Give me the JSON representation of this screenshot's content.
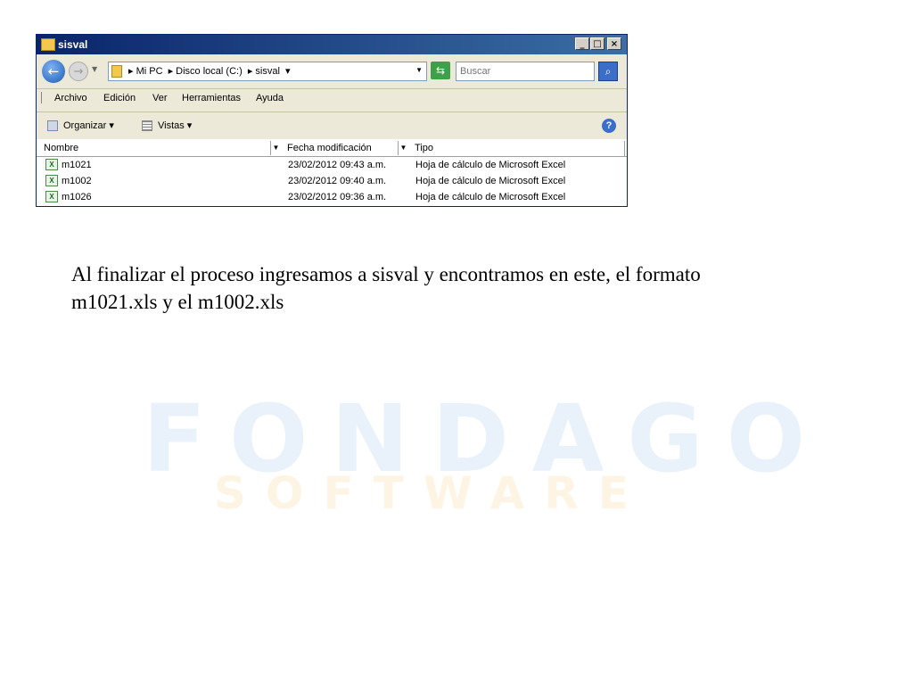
{
  "window": {
    "title": "sisval",
    "buttons": {
      "minimize": "_",
      "maximize": "□",
      "close": "×"
    }
  },
  "address_bar": {
    "crumbs": [
      "▸ Mi PC",
      "▸ Disco local (C:)",
      "▸ sisval",
      "▾"
    ],
    "search_placeholder": "Buscar"
  },
  "menu": [
    "Archivo",
    "Edición",
    "Ver",
    "Herramientas",
    "Ayuda"
  ],
  "command_bar": {
    "organize": "Organizar ▾",
    "views": "Vistas ▾",
    "help": "?"
  },
  "columns": [
    "Nombre",
    "Fecha modificación",
    "Tipo"
  ],
  "files": [
    {
      "name": "m1021",
      "date": "23/02/2012 09:43 a.m.",
      "type": "Hoja de cálculo de Microsoft Excel"
    },
    {
      "name": "m1002",
      "date": "23/02/2012 09:40 a.m.",
      "type": "Hoja de cálculo de Microsoft Excel"
    },
    {
      "name": "m1026",
      "date": "23/02/2012 09:36 a.m.",
      "type": "Hoja de cálculo de Microsoft Excel"
    }
  ],
  "caption": "Al finalizar el proceso ingresamos a sisval y encontramos en este, el formato m1021.xls y el m1002.xls",
  "watermark": {
    "word": "FONDAGO",
    "sub": "SOFTWARE"
  },
  "colors": {
    "title_bar": "#0a246a",
    "toolbar_bg": "#ece9d8",
    "excel_icon": "#4a8a4a"
  }
}
